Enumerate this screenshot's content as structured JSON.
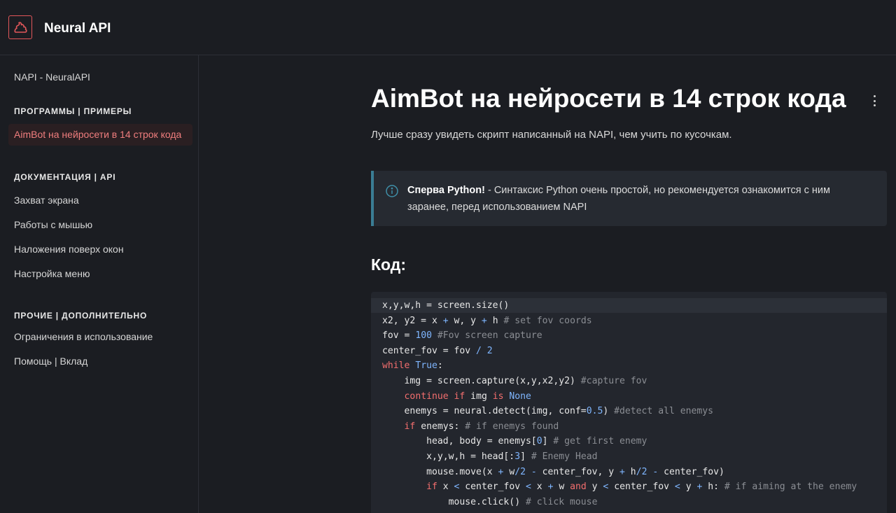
{
  "header": {
    "title": "Neural API",
    "brand_color": "#e2575a"
  },
  "sidebar": {
    "home": "NAPI - NeuralAPI",
    "section_programs": "ПРОГРАММЫ | ПРИМЕРЫ",
    "active_item": "AimBot на нейросети в 14 строк кода",
    "section_docs": "ДОКУМЕНТАЦИЯ | API",
    "docs_items": [
      "Захват экрана",
      "Работы с мышью",
      "Наложения поверх окон",
      "Настройка меню"
    ],
    "section_misc": "ПРОЧИЕ | ДОПОЛНИТЕЛЬНО",
    "misc_items": [
      "Ограничения в использование",
      "Помощь | Вклад"
    ]
  },
  "main": {
    "title": "AimBot на нейросети в 14 строк кода",
    "subtitle": "Лучше сразу увидеть скрипт написанный на NAPI, чем учить по кусочкам.",
    "hint_bold": "Сперва Python!",
    "hint_text": " - Синтаксис Python очень простой, но рекомендуется ознакомится с ним заранее, перед использованием NAPI",
    "code_heading": "Код:",
    "code_lines": [
      [
        [
          "",
          "x,y,w,h = screen.size()"
        ]
      ],
      [
        [
          "",
          "x2, y2 = x "
        ],
        [
          "num",
          "+"
        ],
        [
          "",
          " w, y "
        ],
        [
          "num",
          "+"
        ],
        [
          "",
          " h "
        ],
        [
          "cm",
          "# set fov coords"
        ]
      ],
      [
        [
          "",
          "fov = "
        ],
        [
          "num",
          "100"
        ],
        [
          "",
          " "
        ],
        [
          "cm",
          "#Fov screen capture"
        ]
      ],
      [
        [
          "",
          "center_fov = fov "
        ],
        [
          "num",
          "/"
        ],
        [
          "",
          " "
        ],
        [
          "num",
          "2"
        ]
      ],
      [
        [
          "kw",
          "while"
        ],
        [
          "",
          " "
        ],
        [
          "num",
          "True"
        ],
        [
          "",
          ":"
        ]
      ],
      [
        [
          "",
          "    img = screen.capture(x,y,x2,y2) "
        ],
        [
          "cm",
          "#capture fov"
        ]
      ],
      [
        [
          "",
          "    "
        ],
        [
          "kw",
          "continue"
        ],
        [
          "",
          " "
        ],
        [
          "kw",
          "if"
        ],
        [
          "",
          " img "
        ],
        [
          "kw",
          "is"
        ],
        [
          "",
          " "
        ],
        [
          "num",
          "None"
        ]
      ],
      [
        [
          "",
          "    enemys = neural.detect(img, conf="
        ],
        [
          "num",
          "0.5"
        ],
        [
          "",
          ") "
        ],
        [
          "cm",
          "#detect all enemys"
        ]
      ],
      [
        [
          "",
          "    "
        ],
        [
          "kw",
          "if"
        ],
        [
          "",
          " enemys: "
        ],
        [
          "cm",
          "# if enemys found"
        ]
      ],
      [
        [
          "",
          "        head, body = enemys["
        ],
        [
          "num",
          "0"
        ],
        [
          "",
          "] "
        ],
        [
          "cm",
          "# get first enemy"
        ]
      ],
      [
        [
          "",
          "        x,y,w,h = head[:"
        ],
        [
          "num",
          "3"
        ],
        [
          "",
          "] "
        ],
        [
          "cm",
          "# Enemy Head"
        ]
      ],
      [
        [
          "",
          "        mouse.move(x "
        ],
        [
          "num",
          "+"
        ],
        [
          "",
          " w"
        ],
        [
          "num",
          "/2"
        ],
        [
          "",
          " "
        ],
        [
          "num",
          "-"
        ],
        [
          "",
          " center_fov, y "
        ],
        [
          "num",
          "+"
        ],
        [
          "",
          " h"
        ],
        [
          "num",
          "/2"
        ],
        [
          "",
          " "
        ],
        [
          "num",
          "-"
        ],
        [
          "",
          " center_fov)"
        ]
      ],
      [
        [
          "",
          "        "
        ],
        [
          "kw",
          "if"
        ],
        [
          "",
          " x "
        ],
        [
          "num",
          "<"
        ],
        [
          "",
          " center_fov "
        ],
        [
          "num",
          "<"
        ],
        [
          "",
          " x "
        ],
        [
          "num",
          "+"
        ],
        [
          "",
          " w "
        ],
        [
          "kw",
          "and"
        ],
        [
          "",
          " y "
        ],
        [
          "num",
          "<"
        ],
        [
          "",
          " center_fov "
        ],
        [
          "num",
          "<"
        ],
        [
          "",
          " y "
        ],
        [
          "num",
          "+"
        ],
        [
          "",
          " h: "
        ],
        [
          "cm",
          "# if aiming at the enemy"
        ]
      ],
      [
        [
          "",
          "            mouse.click() "
        ],
        [
          "cm",
          "# click mouse"
        ]
      ]
    ]
  }
}
